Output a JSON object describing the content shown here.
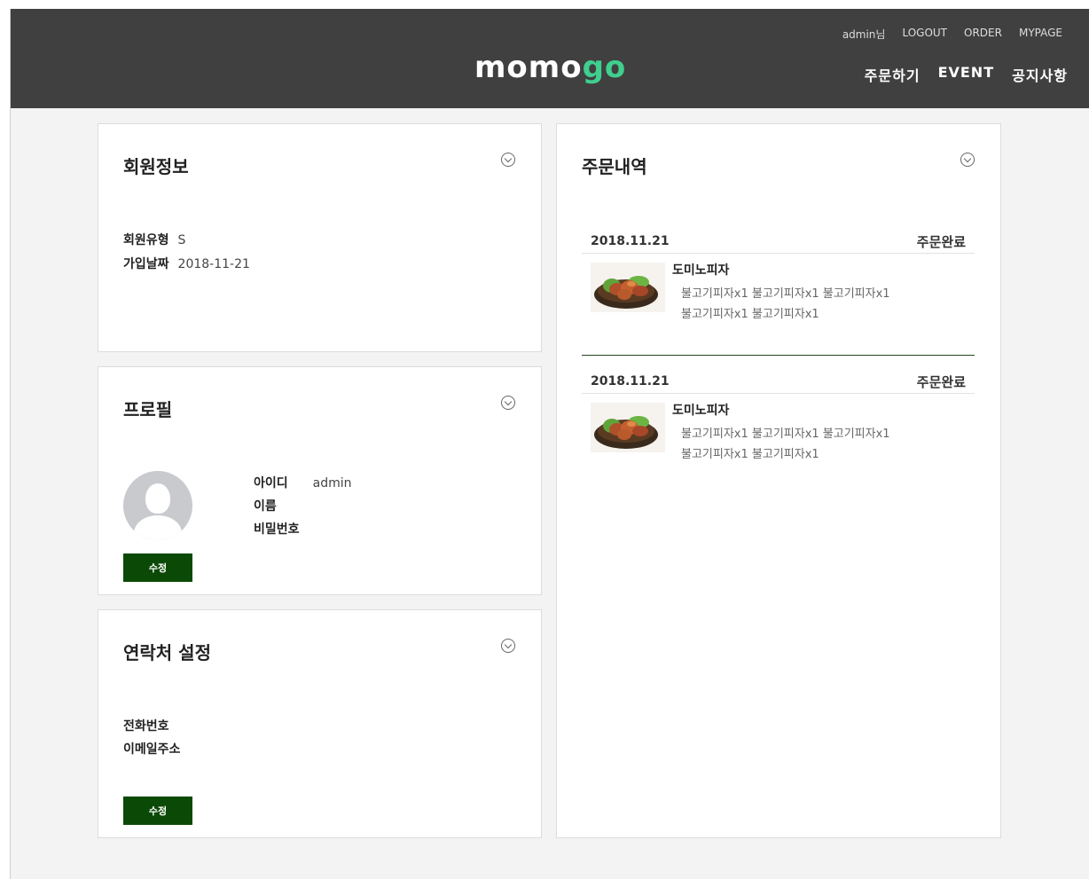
{
  "header": {
    "logo_main": "momo",
    "logo_accent": "go",
    "user_label": "admin님",
    "logout": "LOGOUT",
    "order": "ORDER",
    "mypage": "MYPAGE",
    "nav": [
      "주문하기",
      "EVENT",
      "공지사항"
    ]
  },
  "member_info": {
    "title": "회원정보",
    "type_label": "회원유형",
    "type_value": "S",
    "join_label": "가입날짜",
    "join_value": "2018-11-21"
  },
  "profile": {
    "title": "프로필",
    "id_label": "아이디",
    "id_value": "admin",
    "name_label": "이름",
    "password_label": "비밀번호",
    "edit_label": "수정"
  },
  "contact": {
    "title": "연락처 설정",
    "phone_label": "전화번호",
    "email_label": "이메일주소",
    "edit_label": "수정"
  },
  "orders": {
    "title": "주문내역",
    "list": [
      {
        "date": "2018.11.21",
        "status": "주문완료",
        "store": "도미노피자",
        "items_line1": "불고기피자x1 불고기피자x1 불고기피자x1",
        "items_line2": "불고기피자x1 불고기피자x1"
      },
      {
        "date": "2018.11.21",
        "status": "주문완료",
        "store": "도미노피자",
        "items_line1": "불고기피자x1 불고기피자x1 불고기피자x1",
        "items_line2": "불고기피자x1 불고기피자x1"
      }
    ]
  },
  "colors": {
    "header_bg": "#404040",
    "logo_accent": "#3fcf8e",
    "button_bg": "#0b4a06",
    "page_bg": "#f3f3f3"
  },
  "icons": {
    "panel_toggle": "chevron-circle-down-icon",
    "avatar": "user-silhouette-icon",
    "order_image": "fried-chicken-photo"
  }
}
